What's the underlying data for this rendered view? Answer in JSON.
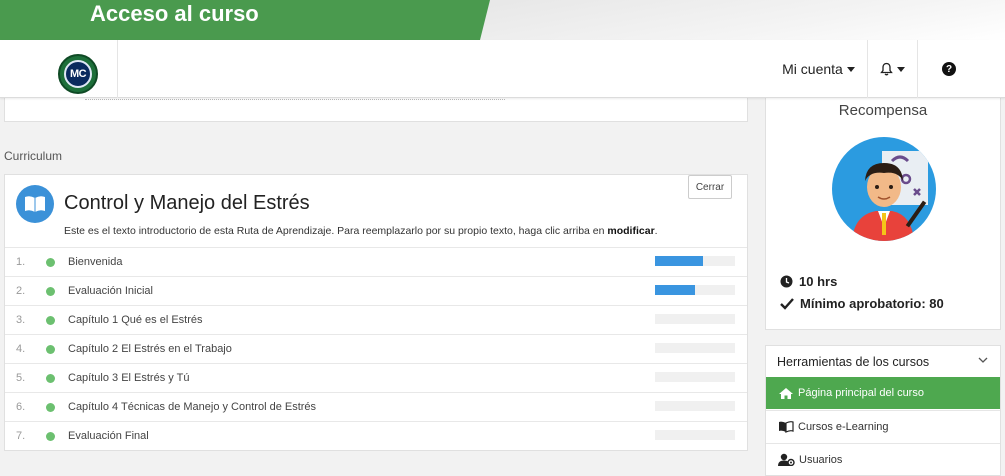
{
  "banner": {
    "title": "Acceso al curso"
  },
  "header": {
    "logo_text": "MC",
    "account_label": "Mi cuenta",
    "icons": [
      "bell-icon",
      "help-icon"
    ]
  },
  "curriculum": {
    "label": "Curriculum",
    "course_title": "Control y Manejo del Estrés",
    "close_label": "Cerrar",
    "intro_text": "Este es el texto introductorio de esta Ruta de Aprendizaje. Para reemplazarlo por su propio texto, haga clic arriba en ",
    "intro_bold": "modificar",
    "intro_end": ".",
    "items": [
      {
        "num": "1.",
        "name": "Bienvenida",
        "progress": 0.6
      },
      {
        "num": "2.",
        "name": "Evaluación Inicial",
        "progress": 0.5
      },
      {
        "num": "3.",
        "name": "Capítulo 1 Qué es el Estrés",
        "progress": 0
      },
      {
        "num": "4.",
        "name": "Capítulo 2 El Estrés en el Trabajo",
        "progress": 0
      },
      {
        "num": "5.",
        "name": "Capítulo 3 El Estrés y Tú",
        "progress": 0
      },
      {
        "num": "6.",
        "name": "Capítulo 4 Técnicas de Manejo y Control de Estrés",
        "progress": 0
      },
      {
        "num": "7.",
        "name": "Evaluación Final",
        "progress": 0
      }
    ]
  },
  "reward": {
    "title": "Recompensa",
    "hours": "10 hrs",
    "min_pass": "Mínimo aprobatorio: 80"
  },
  "tools": {
    "title": "Herramientas de los cursos",
    "items": [
      {
        "label": "Página principal del curso",
        "icon": "home-icon",
        "active": true
      },
      {
        "label": "Cursos e-Learning",
        "icon": "book-icon",
        "active": false
      },
      {
        "label": "Usuarios",
        "icon": "users-icon",
        "active": false
      }
    ]
  },
  "colors": {
    "banner_green": "#4a9a4e",
    "progress_blue": "#3a95e0",
    "status_dot": "#6cc070",
    "active_tool": "#4ea84f"
  }
}
